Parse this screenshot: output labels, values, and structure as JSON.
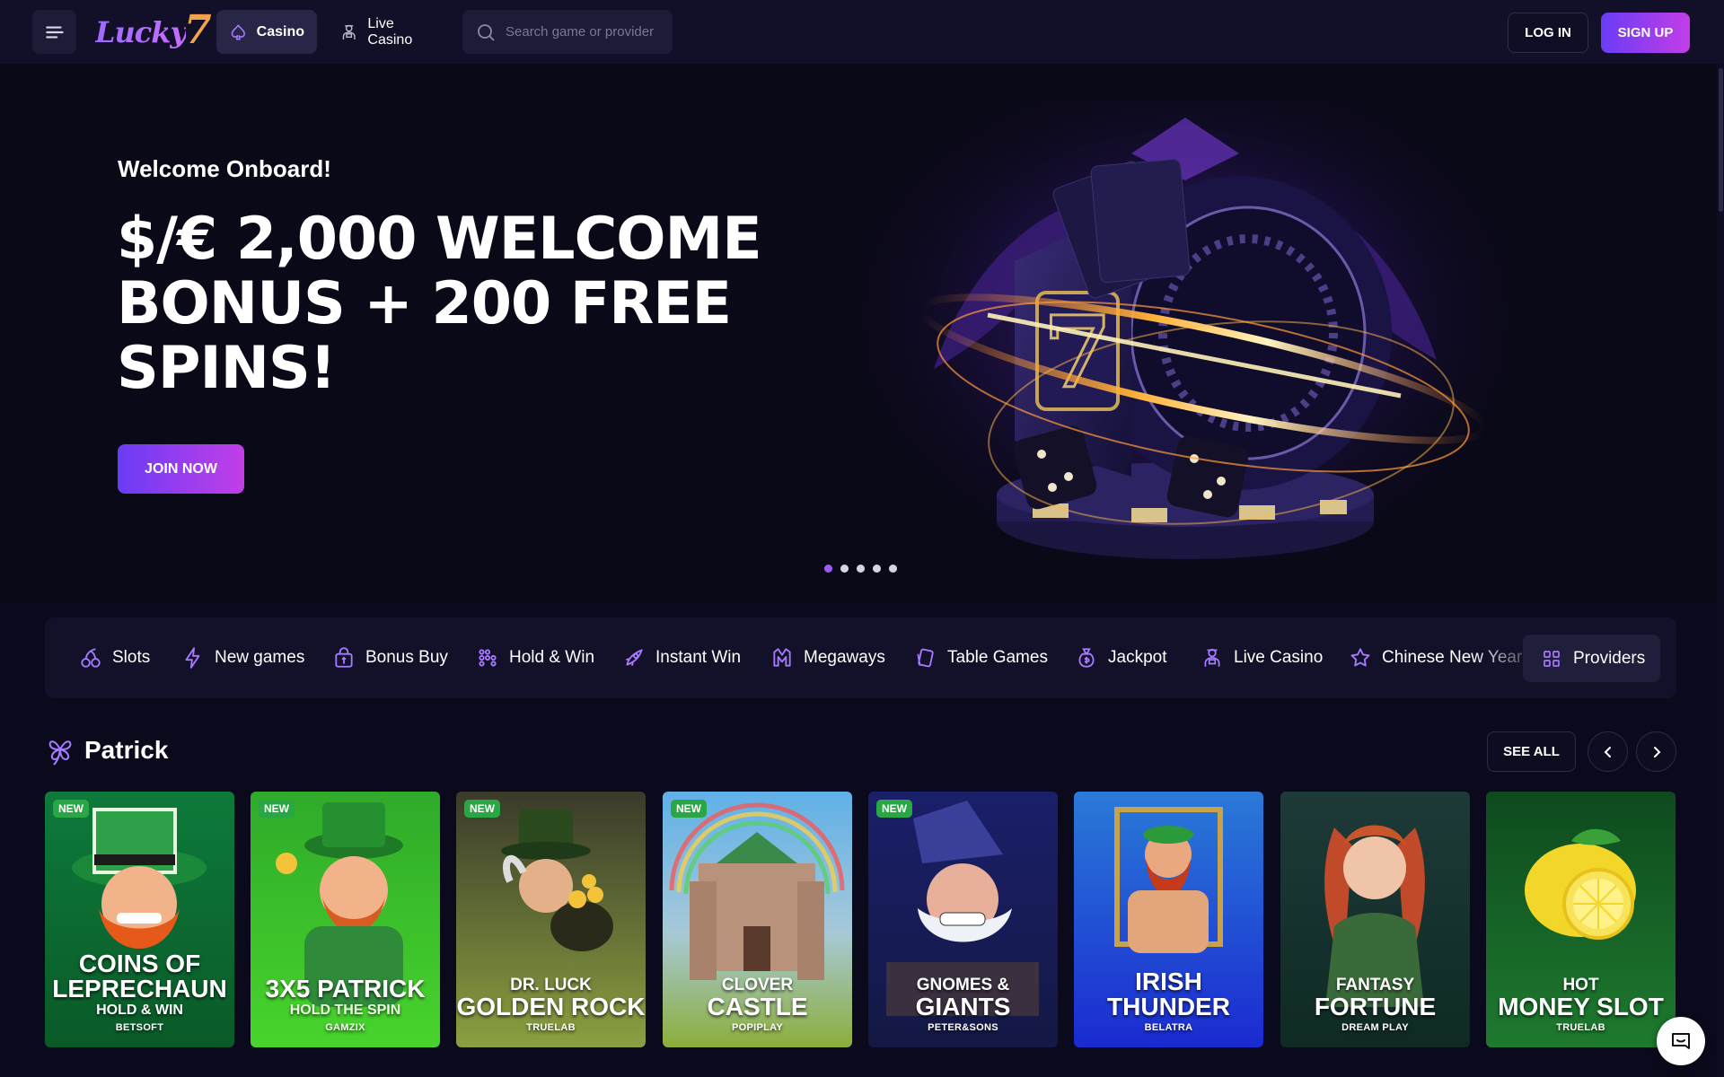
{
  "header": {
    "logo_text": "Lucky",
    "logo_number": "7",
    "tabs": [
      {
        "label": "Casino",
        "icon": "spade-icon",
        "active": true
      },
      {
        "label": "Live Casino",
        "icon": "dealer-icon",
        "active": false
      }
    ],
    "search_placeholder": "Search game or provider",
    "login_label": "LOG IN",
    "signup_label": "SIGN UP"
  },
  "hero": {
    "welcome": "Welcome Onboard!",
    "title": "$/€ 2,000 WELCOME BONUS + 200 FREE SPINS!",
    "join_label": "JOIN NOW",
    "slide_count": 5,
    "active_slide": 0
  },
  "categories": [
    {
      "label": "Slots",
      "icon": "cherry-icon"
    },
    {
      "label": "New games",
      "icon": "lightning-icon"
    },
    {
      "label": "Bonus Buy",
      "icon": "gift-bag-icon"
    },
    {
      "label": "Hold & Win",
      "icon": "dots-grid-icon"
    },
    {
      "label": "Instant Win",
      "icon": "rocket-icon"
    },
    {
      "label": "Megaways",
      "icon": "megaways-icon"
    },
    {
      "label": "Table Games",
      "icon": "cards-icon"
    },
    {
      "label": "Jackpot",
      "icon": "money-bag-icon"
    },
    {
      "label": "Live Casino",
      "icon": "dealer-icon"
    },
    {
      "label": "Chinese New Year",
      "icon": "star-icon"
    }
  ],
  "providers_label": "Providers",
  "section": {
    "title": "Patrick",
    "icon": "clover-icon",
    "see_all_label": "SEE ALL"
  },
  "games": [
    {
      "line1": "COINS OF",
      "line2": "LEPRECHAUN",
      "sub": "HOLD & WIN",
      "provider": "BETSOFT",
      "badge": "NEW"
    },
    {
      "line1": "",
      "line2": "3X5 PATRICK",
      "sub": "HOLD THE SPIN",
      "provider": "GAMZIX",
      "badge": "NEW"
    },
    {
      "line1": "DR. LUCK",
      "line2": "GOLDEN ROCK",
      "sub": "",
      "provider": "TRUELAB",
      "badge": "NEW"
    },
    {
      "line1": "CLOVER",
      "line2": "CASTLE",
      "sub": "",
      "provider": "POPIPLAY",
      "badge": "NEW"
    },
    {
      "line1": "GNOMES &",
      "line2": "GIANTS",
      "sub": "",
      "provider": "PETER&SONS",
      "badge": "NEW"
    },
    {
      "line1": "IRISH",
      "line2": "THUNDER",
      "sub": "",
      "provider": "BELATRA",
      "badge": ""
    },
    {
      "line1": "FANTASY",
      "line2": "FORTUNE",
      "sub": "",
      "provider": "DREAM PLAY",
      "badge": ""
    },
    {
      "line1": "HOT",
      "line2": "MONEY SLOT",
      "sub": "",
      "provider": "TRUELAB",
      "badge": ""
    }
  ],
  "colors": {
    "background": "#0b0a1c",
    "header": "#111028",
    "accent_start": "#6a3cf5",
    "accent_end": "#c23ee8",
    "new_badge": "#2aa745"
  }
}
